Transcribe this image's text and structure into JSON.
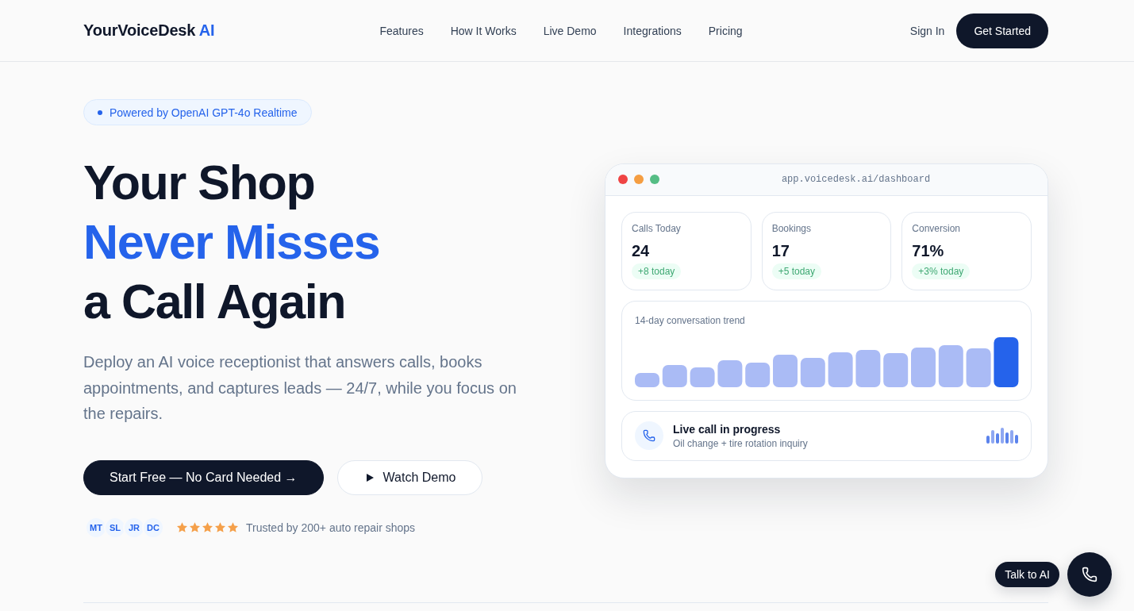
{
  "nav": {
    "logo": {
      "text": "YourVoiceDesk",
      "accent": "AI"
    },
    "links": [
      "Features",
      "How It Works",
      "Live Demo",
      "Integrations",
      "Pricing"
    ],
    "sign_in": "Sign In",
    "cta": "Get Started"
  },
  "hero": {
    "badge": "Powered by OpenAI GPT-4o Realtime",
    "headline": [
      {
        "text": "Your Shop",
        "highlight": false
      },
      {
        "text": "Never Misses",
        "highlight": true
      },
      {
        "text": "a Call Again",
        "highlight": false
      }
    ],
    "description": "Deploy an AI voice receptionist that answers calls, books appointments, and captures leads — 24/7, while you focus on the repairs.",
    "buttons": [
      {
        "label": "Start Free — No Card Needed →",
        "kind": "primary"
      },
      {
        "label": "Watch Demo",
        "kind": "secondary"
      }
    ],
    "avatars": [
      "MT",
      "SL",
      "JR",
      "DC"
    ],
    "rating": {
      "stars": 5
    },
    "trust_text": "Trusted by 200+ auto repair shops"
  },
  "dashboard": {
    "url": "app.voicedesk.ai/dashboard",
    "stats": [
      {
        "label": "Calls Today",
        "value": "24",
        "change": "+8 today"
      },
      {
        "label": "Bookings",
        "value": "17",
        "change": "+5 today"
      },
      {
        "label": "Conversion",
        "value": "71%",
        "change": "+3% today"
      }
    ],
    "trend": {
      "title": "14-day conversation trend"
    },
    "live_call": {
      "title": "Live call in progress",
      "subtitle": "Oil change + tire rotation inquiry"
    }
  },
  "chat_widget": {
    "label": "Talk to AI"
  }
}
